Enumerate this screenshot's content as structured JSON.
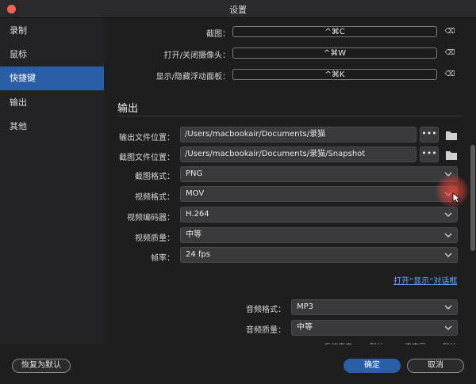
{
  "window": {
    "title": "设置"
  },
  "sidebar": {
    "items": [
      {
        "label": "录制"
      },
      {
        "label": "鼠标"
      },
      {
        "label": "快捷键"
      },
      {
        "label": "输出"
      },
      {
        "label": "其他"
      }
    ]
  },
  "shortcuts": [
    {
      "label": "截图：",
      "value": "^⌘C"
    },
    {
      "label": "打开/关闭摄像头：",
      "value": "^⌘W"
    },
    {
      "label": "显示/隐藏浮动面板：",
      "value": "^⌘K"
    }
  ],
  "output": {
    "section_title": "输出",
    "output_folder": {
      "label": "输出文件位置：",
      "value": "/Users/macbookair/Documents/录猫"
    },
    "snapshot_folder": {
      "label": "截图文件位置：",
      "value": "/Users/macbookair/Documents/录猫/Snapshot"
    },
    "dots_label": "•••",
    "selects": [
      {
        "label": "截图格式：",
        "value": "PNG"
      },
      {
        "label": "视频格式：",
        "value": "MOV"
      },
      {
        "label": "视频编码器：",
        "value": "H.264"
      },
      {
        "label": "视频质量：",
        "value": "中等"
      },
      {
        "label": "帧率：",
        "value": "24 fps"
      }
    ],
    "display_link": "打开“显示”对话框",
    "audio_selects": [
      {
        "label": "音频格式：",
        "value": "MP3"
      },
      {
        "label": "音频质量：",
        "value": "中等"
      }
    ],
    "partial_row": {
      "system_sound": "系统声音：",
      "system_default": "默认",
      "mic": "麦克风：",
      "mic_default": "默认"
    }
  },
  "footer": {
    "reset": "恢复为默认",
    "ok": "确定",
    "cancel": "取消"
  },
  "colors": {
    "accent": "#2b5ea9",
    "close": "#fe5f57",
    "link": "#6aa2ff"
  }
}
